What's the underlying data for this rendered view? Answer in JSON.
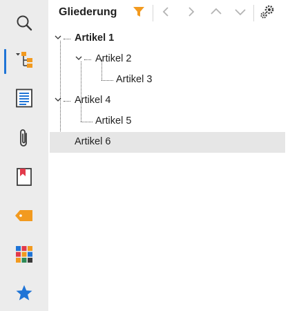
{
  "sidebar": {
    "items": [
      {
        "icon": "search-icon"
      },
      {
        "icon": "outline-tree-icon",
        "active": true
      },
      {
        "icon": "page-icon"
      },
      {
        "icon": "paperclip-icon"
      },
      {
        "icon": "bookmark-icon"
      },
      {
        "icon": "tag-icon"
      },
      {
        "icon": "layers-grid-icon"
      },
      {
        "icon": "star-icon"
      }
    ]
  },
  "panel": {
    "title": "Gliederung",
    "toolbar": [
      "filter-icon",
      "previous-arrow-icon",
      "next-arrow-icon",
      "up-arrow-icon",
      "down-arrow-icon",
      "settings-gears-icon"
    ]
  },
  "tree": {
    "items": [
      {
        "label": "Artikel 1",
        "bold": true,
        "expanded": true
      },
      {
        "label": "Artikel 2",
        "expanded": true
      },
      {
        "label": "Artikel 3"
      },
      {
        "label": "Artikel 4",
        "expanded": true
      },
      {
        "label": "Artikel 5"
      },
      {
        "label": "Artikel 6",
        "selected": true
      }
    ]
  },
  "colors": {
    "accent_orange": "#f29a1f",
    "accent_blue": "#1f74d6",
    "sidebar_bg": "#ececec",
    "selection_bg": "#e6e6e6"
  }
}
